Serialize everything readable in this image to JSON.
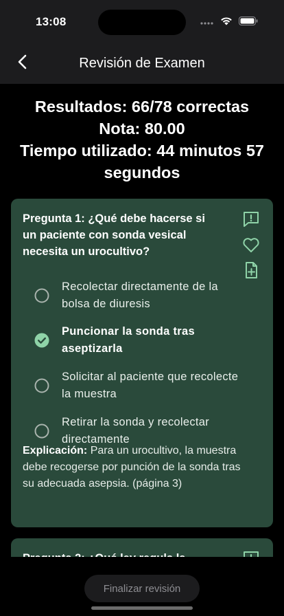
{
  "status": {
    "time": "13:08"
  },
  "nav": {
    "title": "Revisión de Examen",
    "back_icon": "chevron-left-icon"
  },
  "results": {
    "line1": "Resultados: 66/78 correctas",
    "line2": "Nota: 80.00",
    "line3": "Tiempo utilizado: 44 minutos 57 segundos"
  },
  "questions": [
    {
      "title": "Pregunta 1: ¿Qué debe hacerse si un paciente con sonda vesical necesita un urocultivo?",
      "options": [
        {
          "label": "Recolectar directamente de la bolsa de diuresis",
          "selected": false
        },
        {
          "label": "Puncionar la sonda tras aseptizarla",
          "selected": true
        },
        {
          "label": "Solicitar al paciente que recolecte la muestra",
          "selected": false
        },
        {
          "label": "Retirar la sonda y recolectar directamente",
          "selected": false
        }
      ],
      "explanation_label": "Explicación:",
      "explanation_text": "Para un urocultivo, la muestra debe recogerse por punción de la sonda tras su adecuada asepsia. (página 3)"
    },
    {
      "title": "Pregunta 2: ¿Qué ley regula la"
    }
  ],
  "footer": {
    "finish_label": "Finalizar revisión"
  },
  "colors": {
    "card_bg": "#2a4a3b",
    "accent": "#8fd3a8",
    "background": "#000000"
  }
}
